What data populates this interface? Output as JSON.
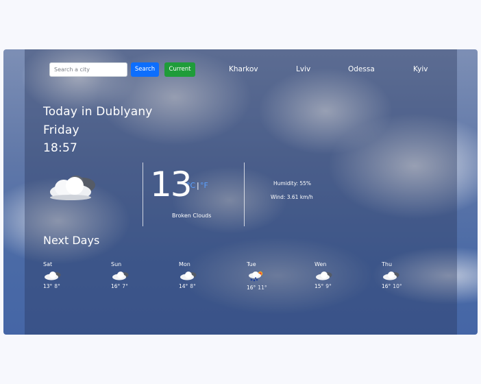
{
  "search": {
    "placeholder": "Search a city",
    "value": ""
  },
  "buttons": {
    "search_label": "Search",
    "current_label": "Current"
  },
  "cities": [
    "Kharkov",
    "Lviv",
    "Odessa",
    "Kyiv"
  ],
  "today": {
    "heading": "Today in Dublyany",
    "weekday": "Friday",
    "time": "18:57"
  },
  "current": {
    "temperature": "13",
    "unit_c": "°C",
    "unit_sep": "|",
    "unit_f": "°F",
    "description": "Broken Clouds",
    "humidity": "Humidity: 55%",
    "wind": "Wind: 3.61 km/h",
    "icon": "broken-clouds-icon"
  },
  "forecast_title": "Next Days",
  "forecast": [
    {
      "day": "Sat",
      "high": "13°",
      "low": "8°",
      "icon": "broken-clouds-icon"
    },
    {
      "day": "Sun",
      "high": "16°",
      "low": "7°",
      "icon": "broken-clouds-icon"
    },
    {
      "day": "Mon",
      "high": "14°",
      "low": "8°",
      "icon": "broken-clouds-icon"
    },
    {
      "day": "Tue",
      "high": "16°",
      "low": "11°",
      "icon": "sun-rain-cloud-icon"
    },
    {
      "day": "Wen",
      "high": "15°",
      "low": "9°",
      "icon": "broken-clouds-icon"
    },
    {
      "day": "Thu",
      "high": "16°",
      "low": "10°",
      "icon": "broken-clouds-icon"
    }
  ],
  "colors": {
    "search_button": "#0d6efd",
    "current_button": "#1f9c3a",
    "unit_link": "#5aa0ff"
  }
}
